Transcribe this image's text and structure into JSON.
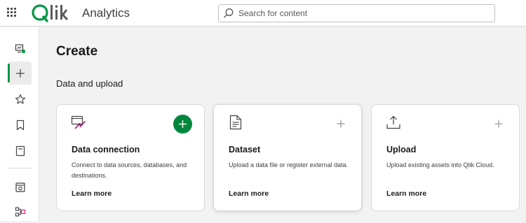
{
  "header": {
    "menu_icon": "grid-menu-icon",
    "logo_text": "Qlik",
    "app_name": "Analytics",
    "search_placeholder": "Search for content",
    "search_value": ""
  },
  "sidebar": {
    "items": [
      {
        "name": "home",
        "icon": "home-analytics-icon"
      },
      {
        "name": "create",
        "icon": "plus-icon",
        "active": true
      },
      {
        "name": "favorites",
        "icon": "star-icon"
      },
      {
        "name": "catalog",
        "icon": "bookmark-icon"
      },
      {
        "name": "collections",
        "icon": "notebook-icon"
      },
      {
        "name": "automations",
        "icon": "monitor-icon"
      },
      {
        "name": "data-integration",
        "icon": "flow-icon"
      }
    ]
  },
  "main": {
    "title": "Create",
    "section_title": "Data and upload",
    "cards": [
      {
        "title": "Data connection",
        "description": "Connect to data sources, databases, and destinations.",
        "link": "Learn more",
        "icon": "data-connection-icon"
      },
      {
        "title": "Dataset",
        "description": "Upload a data file or register external data.",
        "link": "Learn more",
        "icon": "document-icon"
      },
      {
        "title": "Upload",
        "description": "Upload existing assets into Qlik Cloud.",
        "link": "Learn more",
        "icon": "upload-icon"
      }
    ]
  },
  "colors": {
    "accent": "#009845",
    "add_button": "#00873d",
    "background": "#f2f2f2"
  }
}
